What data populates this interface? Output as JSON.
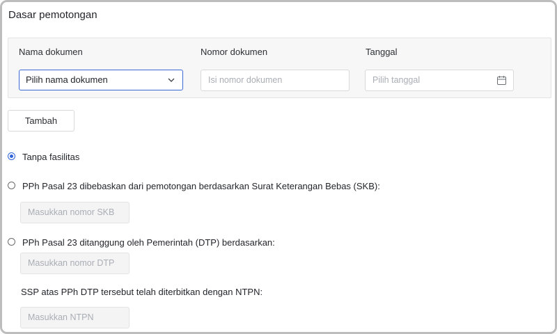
{
  "section": {
    "title": "Dasar pemotongan"
  },
  "document_table": {
    "columns": [
      "Nama dokumen",
      "Nomor dokumen",
      "Tanggal"
    ],
    "nama_dokumen": {
      "value": "Pilih nama dokumen",
      "icon": "chevron-down-icon"
    },
    "nomor_dokumen": {
      "placeholder": "Isi nomor dokumen"
    },
    "tanggal": {
      "placeholder": "Pilih tanggal",
      "icon": "calendar-icon"
    }
  },
  "add_button": {
    "label": "Tambah"
  },
  "options": [
    {
      "label": "Tanpa fasilitas",
      "checked": true
    },
    {
      "label": "PPh Pasal 23 dibebaskan dari pemotongan berdasarkan Surat Keterangan Bebas (SKB):",
      "checked": false
    },
    {
      "label": "PPh Pasal 23 ditanggung oleh Pemerintah (DTP) berdasarkan:",
      "checked": false
    }
  ],
  "skb_input": {
    "placeholder": "Masukkan nomor SKB"
  },
  "dtp_input": {
    "placeholder": "Masukkan nomor DTP"
  },
  "ntpn": {
    "label": "SSP atas PPh DTP tersebut telah diterbitkan dengan NTPN:",
    "placeholder": "Masukkan NTPN"
  },
  "colors": {
    "accent": "#2f62d6",
    "border": "#d9d9d9",
    "panel": "#f7f7f8"
  }
}
